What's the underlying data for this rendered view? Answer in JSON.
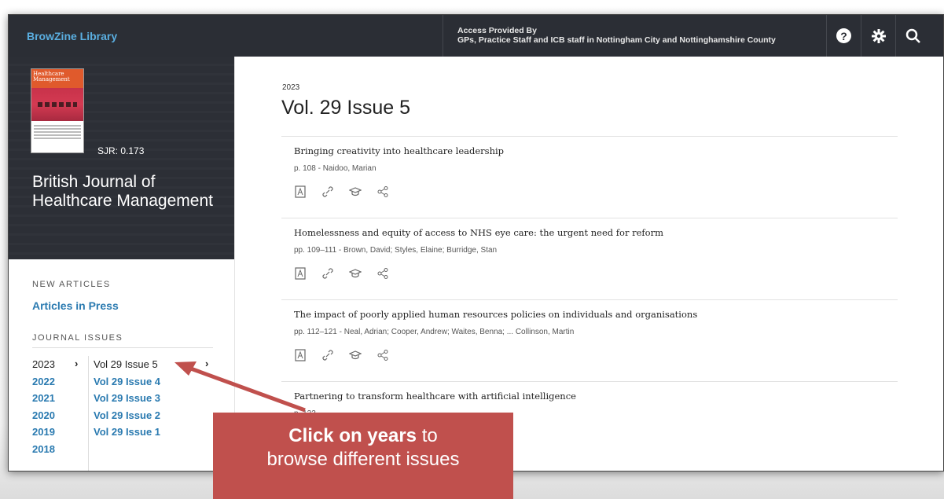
{
  "topbar": {
    "brand": "BrowZine Library",
    "access_line1": "Access Provided By",
    "access_line2": "GPs, Practice Staff and ICB staff in Nottingham City and Nottinghamshire County",
    "help_symbol": "?",
    "icons": [
      "help-icon",
      "gear-icon",
      "search-icon"
    ]
  },
  "journal": {
    "cover_text": "Healthcare Management",
    "sjr": "SJR: 0.173",
    "title": "British Journal of Healthcare Management"
  },
  "sidebar": {
    "new_articles_heading": "NEW ARTICLES",
    "articles_in_press": "Articles in Press",
    "journal_issues_heading": "JOURNAL ISSUES",
    "years": [
      "2023",
      "2022",
      "2021",
      "2020",
      "2019",
      "2018"
    ],
    "issues": [
      "Vol 29 Issue 5",
      "Vol 29 Issue 4",
      "Vol 29 Issue 3",
      "Vol 29 Issue 2",
      "Vol 29 Issue 1"
    ]
  },
  "main": {
    "year": "2023",
    "issue_title": "Vol. 29 Issue 5",
    "articles": [
      {
        "title": "Bringing creativity into healthcare leadership",
        "meta": "p. 108  -  Naidoo, Marian"
      },
      {
        "title": "Homelessness and equity of access to NHS eye care: the urgent need for reform",
        "meta": "pp. 109–111  -  Brown, David; Styles, Elaine; Burridge, Stan"
      },
      {
        "title": "The impact of poorly applied human resources policies on individuals and organisations",
        "meta": "pp. 112–121  -  Neal, Adrian; Cooper, Andrew; Waites, Benna; ... Collinson, Martin"
      },
      {
        "title": "Partnering to transform healthcare with artificial intelligence",
        "meta": "p. 122"
      }
    ]
  },
  "callout": {
    "bold": "Click on years",
    "rest_line1": " to",
    "line2": "browse different issues",
    "color": "#c0504d"
  }
}
